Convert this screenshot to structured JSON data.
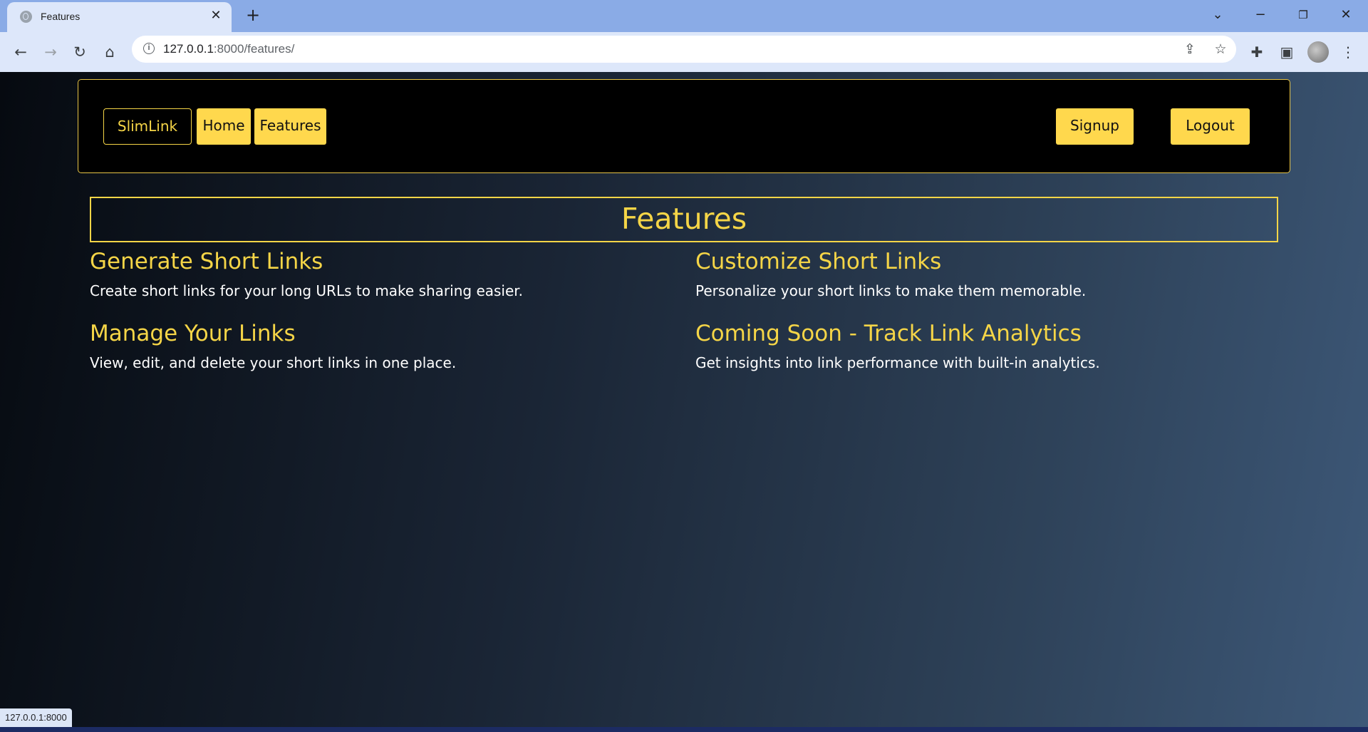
{
  "browser": {
    "tab": {
      "title": "Features"
    },
    "address": {
      "host": "127.0.0.1",
      "path": ":8000/features/"
    },
    "status_url": "127.0.0.1:8000"
  },
  "navbar": {
    "brand": "SlimLink",
    "left_links": [
      "Home",
      "Features"
    ],
    "right_links": [
      "Signup",
      "Logout"
    ]
  },
  "main": {
    "title": "Features",
    "features": [
      {
        "heading": "Generate Short Links",
        "text": "Create short links for your long URLs to make sharing easier."
      },
      {
        "heading": "Customize Short Links",
        "text": "Personalize your short links to make them memorable."
      },
      {
        "heading": "Manage Your Links",
        "text": "View, edit, and delete your short links in one place."
      },
      {
        "heading": "Coming Soon - Track Link Analytics",
        "text": "Get insights into link performance with built-in analytics."
      }
    ]
  },
  "colors": {
    "accent": "#f5d547",
    "button_bg": "#ffd84d",
    "navbar_bg": "#000000"
  },
  "icons": {
    "tab_favicon": "globe-icon",
    "back": "back-arrow-icon",
    "forward": "forward-arrow-icon",
    "reload": "reload-icon",
    "home": "home-icon",
    "site_info": "info-icon",
    "share": "share-icon",
    "bookmark": "star-icon",
    "extensions": "puzzle-icon",
    "side_panel": "side-panel-icon",
    "menu": "kebab-menu-icon"
  }
}
